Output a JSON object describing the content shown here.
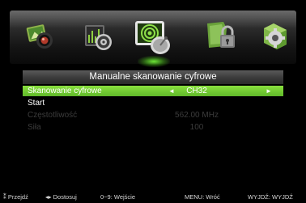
{
  "menu": {
    "title": "Manualne skanowanie cyfrowe",
    "rows": [
      {
        "label": "Skanowanie cyfrowe",
        "value": "CH32",
        "left_arrow": "◄",
        "right_arrow": "►"
      },
      {
        "label": "Start"
      },
      {
        "label": "Częstotliwość",
        "value": "562.00 MHz"
      },
      {
        "label": "Siła",
        "value": "100"
      }
    ]
  },
  "hints": {
    "move": "⁑ Przejdź",
    "adjust": "◂▸ Dostosuj",
    "digits": "0~9: Wejście",
    "menu": "MENU: Wróć",
    "exit": "WYJDŹ: WYJDŹ"
  },
  "icons": [
    "picture-icon",
    "sound-icon",
    "channel-icon",
    "lock-icon",
    "settings-icon"
  ],
  "colors": {
    "accent": "#7ad437",
    "dim_text": "#3c3c3c"
  }
}
